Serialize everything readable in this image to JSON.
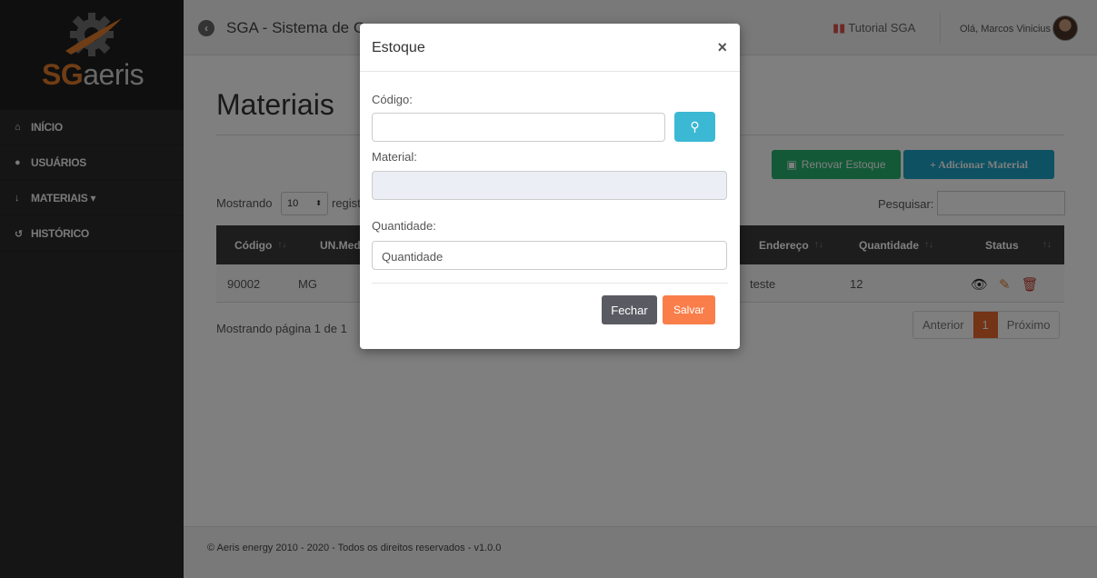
{
  "brand": {
    "sg": "SG",
    "aeris": "aeris"
  },
  "sidebar": {
    "items": [
      {
        "icon": "home-icon",
        "glyph": "⌂",
        "label": "INÍCIO"
      },
      {
        "icon": "user-icon",
        "glyph": "●",
        "label": "USUÁRIOS"
      },
      {
        "icon": "materials-icon",
        "glyph": "↓",
        "label": "MATERIAIS ▾"
      },
      {
        "icon": "history-icon",
        "glyph": "↺",
        "label": "HISTÓRICO"
      }
    ]
  },
  "topbar": {
    "title": "SGA - Sistema de G",
    "tutorial": "Tutorial SGA",
    "greeting": "Olá, Marcos Vinicius"
  },
  "main": {
    "page_title": "Materiais",
    "renovar_label": "Renovar Estoque",
    "adicionar_label": "+ Adicionar Material",
    "show_label": "Mostrando",
    "page_length": "10",
    "show_label_tail": "regist",
    "search_label": "Pesquisar:",
    "columns": [
      "Código",
      "UN.Med",
      "Endereço",
      "Quantidade",
      "Status"
    ],
    "rows": [
      {
        "codigo": "90002",
        "unmed": "MG",
        "endereco": "teste",
        "quantidade": "12"
      }
    ],
    "paging_info": "Mostrando página 1 de 1",
    "pager": {
      "prev": "Anterior",
      "current": "1",
      "next": "Próximo"
    }
  },
  "footer": {
    "text": "© Aeris energy 2010 - 2020 - Todos os direitos reservados - v1.0.0"
  },
  "modal": {
    "title": "Estoque",
    "close": "×",
    "codigo_label": "Código:",
    "codigo_value": "",
    "material_label": "Material:",
    "material_value": "",
    "quantidade_label": "Quantidade:",
    "quantidade_placeholder": "Quantidade",
    "fechar": "Fechar",
    "salvar": "Salvar"
  },
  "colors": {
    "accent_orange": "#e8692c",
    "success_green": "#26b26f",
    "info_blue": "#1aa3c4",
    "sidebar_bg": "#2a2a2a"
  }
}
